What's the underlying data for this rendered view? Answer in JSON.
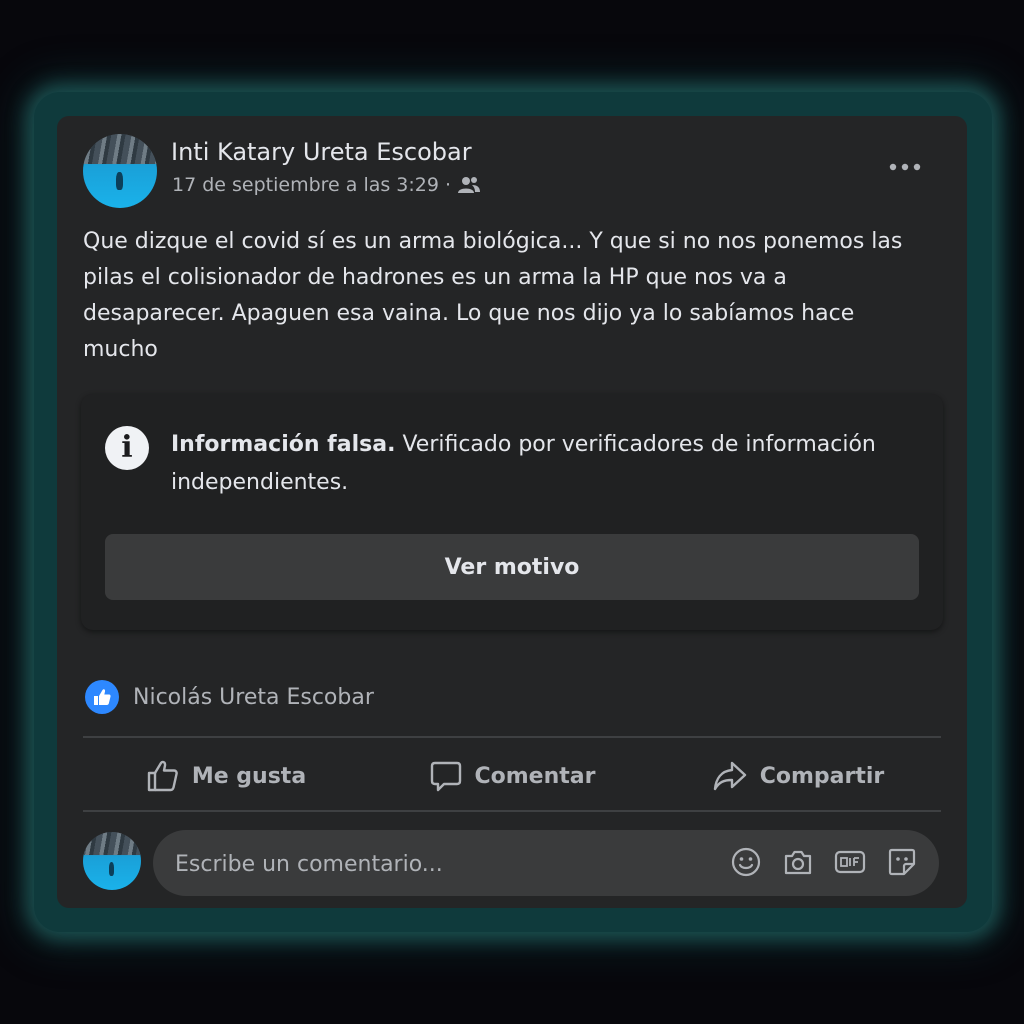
{
  "post": {
    "author": "Inti Katary Ureta Escobar",
    "timestamp": "17 de septiembre a las 3:29",
    "separator": "·",
    "audience_icon": "friends-icon",
    "text": "Que dizque el covid sí es un arma biológica... Y que si no nos ponemos las pilas el colisionador de hadrones es un arma la HP que nos va a desaparecer. Apaguen esa vaina. Lo que nos dijo ya lo sabíamos hace mucho"
  },
  "fact_check": {
    "icon": "info-icon",
    "icon_glyph": "i",
    "title": "Información falsa.",
    "description": "Verificado por verificadores de información independientes.",
    "button_label": "Ver motivo"
  },
  "reactions": {
    "icon": "like-reaction-icon",
    "names": "Nicolás Ureta Escobar"
  },
  "actions": {
    "like": "Me gusta",
    "comment": "Comentar",
    "share": "Compartir"
  },
  "comment_box": {
    "placeholder": "Escribe un comentario...",
    "tools": [
      "emoji-icon",
      "camera-icon",
      "gif-icon",
      "sticker-icon"
    ]
  },
  "colors": {
    "card": "#242526",
    "accent": "#2d88ff",
    "text_primary": "#e4e6eb",
    "text_secondary": "#b0b3b8",
    "glow": "#2a7a78"
  }
}
